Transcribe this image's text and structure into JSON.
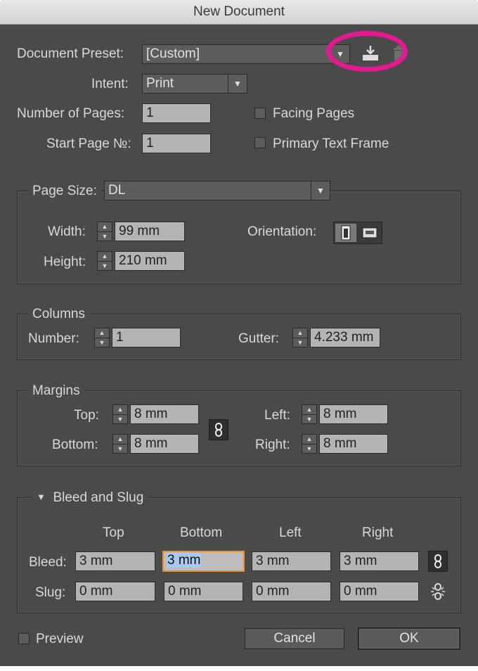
{
  "title": "New Document",
  "preset": {
    "label": "Document Preset:",
    "value": "[Custom]"
  },
  "intent": {
    "label": "Intent:",
    "value": "Print"
  },
  "pages": {
    "label": "Number of Pages:",
    "value": "1"
  },
  "start_page": {
    "label": "Start Page №:",
    "value": "1"
  },
  "facing_pages": {
    "label": "Facing Pages",
    "checked": false
  },
  "primary_text_frame": {
    "label": "Primary Text Frame",
    "checked": false
  },
  "page_size": {
    "label": "Page Size:",
    "value": "DL",
    "width_label": "Width:",
    "width": "99 mm",
    "height_label": "Height:",
    "height": "210 mm",
    "orientation_label": "Orientation:"
  },
  "columns": {
    "title": "Columns",
    "number_label": "Number:",
    "number": "1",
    "gutter_label": "Gutter:",
    "gutter": "4.233 mm"
  },
  "margins": {
    "title": "Margins",
    "top_label": "Top:",
    "top": "8 mm",
    "bottom_label": "Bottom:",
    "bottom": "8 mm",
    "left_label": "Left:",
    "left": "8 mm",
    "right_label": "Right:",
    "right": "8 mm"
  },
  "bleed_slug": {
    "title": "Bleed and Slug",
    "col_top": "Top",
    "col_bottom": "Bottom",
    "col_left": "Left",
    "col_right": "Right",
    "bleed_label": "Bleed:",
    "bleed": {
      "top": "3 mm",
      "bottom": "3 mm",
      "left": "3 mm",
      "right": "3 mm"
    },
    "slug_label": "Slug:",
    "slug": {
      "top": "0 mm",
      "bottom": "0 mm",
      "left": "0 mm",
      "right": "0 mm"
    }
  },
  "preview": {
    "label": "Preview",
    "checked": false
  },
  "buttons": {
    "cancel": "Cancel",
    "ok": "OK"
  },
  "colors": {
    "background": "#4a4a4a",
    "field": "#b4b4b4",
    "focus": "#e8922c",
    "annotation_ring": "#e3198f"
  },
  "icons": [
    "save-preset-icon",
    "delete-preset-icon",
    "portrait-icon",
    "landscape-icon",
    "link-icon",
    "unlinked-icon",
    "disclosure-triangle-icon"
  ]
}
